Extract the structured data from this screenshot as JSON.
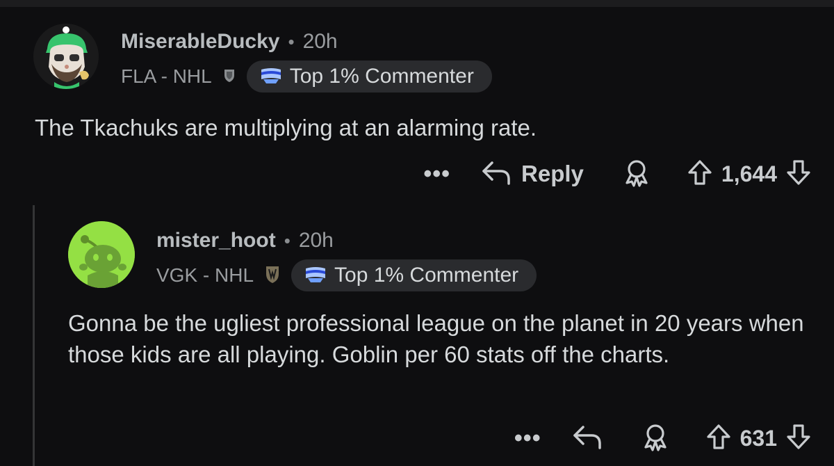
{
  "comments": [
    {
      "username": "MiserableDucky",
      "separator": "•",
      "time": "20h",
      "flair": "FLA - NHL",
      "badge": "Top 1% Commenter",
      "body": "The Tkachuks are multiplying at an alarming rate.",
      "more": "•••",
      "reply_label": "Reply",
      "score": "1,644"
    },
    {
      "username": "mister_hoot",
      "separator": "•",
      "time": "20h",
      "flair": "VGK - NHL",
      "badge": "Top 1% Commenter",
      "body": "Gonna be the ugliest professional league on the planet in 20 years when those kids are all playing. Goblin per 60 stats off the charts.",
      "more": "•••",
      "score": "631"
    }
  ],
  "icons": {
    "reply": "reply-arrow-icon",
    "award": "award-icon",
    "upvote": "upvote-arrow-icon",
    "downvote": "downvote-arrow-icon",
    "badge": "top-commenter-icon"
  },
  "colors": {
    "background": "#0e0e10",
    "avatar2_bg": "#94e044",
    "badge_bg": "#2a2b2e"
  }
}
